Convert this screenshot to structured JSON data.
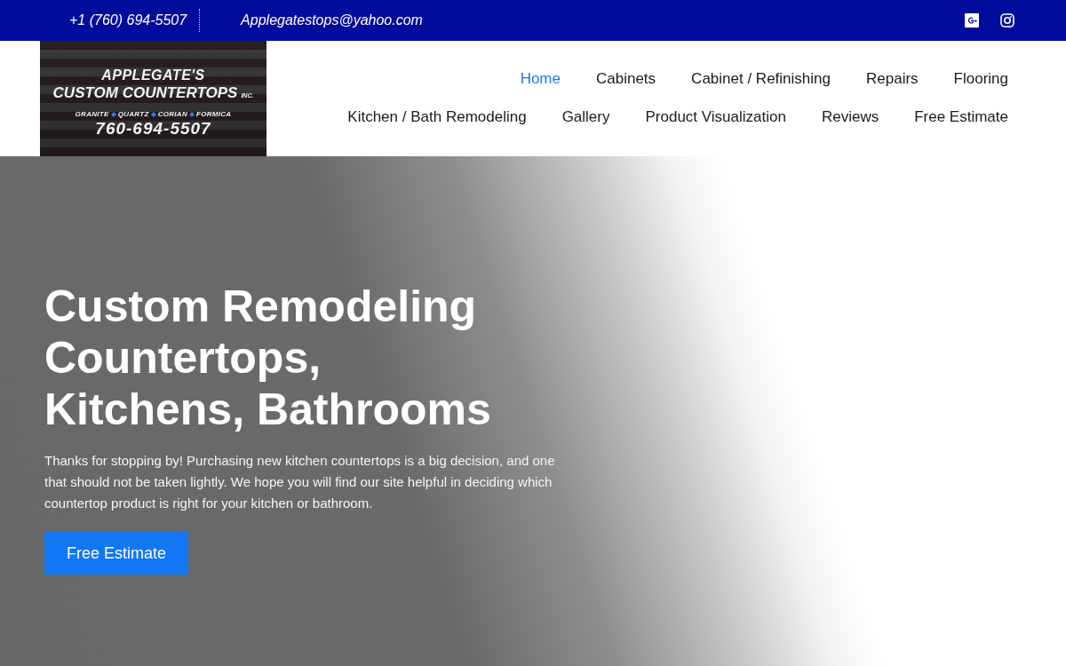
{
  "top_bar": {
    "phone": "+1 (760) 694-5507",
    "email": "Applegatestops@yahoo.com"
  },
  "logo": {
    "name": "APPLEGATE'S",
    "tagline": "CUSTOM COUNTERTOPS",
    "suffix": "INC.",
    "materials": [
      "GRANITE",
      "QUARTZ",
      "CORIAN",
      "FORMICA"
    ],
    "phone": "760-694-5507"
  },
  "nav": {
    "rows": [
      [
        {
          "label": "Home",
          "selected": true
        },
        {
          "label": "Cabinets",
          "selected": false
        },
        {
          "label": "Cabinet / Refinishing",
          "selected": false
        },
        {
          "label": "Repairs",
          "selected": false
        },
        {
          "label": "Flooring",
          "selected": false
        }
      ],
      [
        {
          "label": "Kitchen / Bath Remodeling",
          "selected": false
        },
        {
          "label": "Gallery",
          "selected": false
        },
        {
          "label": "Product Visualization",
          "selected": false
        },
        {
          "label": "Reviews",
          "selected": false
        },
        {
          "label": "Free Estimate",
          "selected": false
        }
      ]
    ]
  },
  "hero": {
    "headline": [
      "Custom Remodeling",
      "Countertops,",
      "Kitchens, Bathrooms"
    ],
    "text": "Thanks for stopping by! Purchasing new kitchen countertops is a big decision, and one that should not be taken lightly. We hope you will find our site helpful in deciding which countertop product is right for your kitchen or bathroom.",
    "button": "Free Estimate"
  }
}
